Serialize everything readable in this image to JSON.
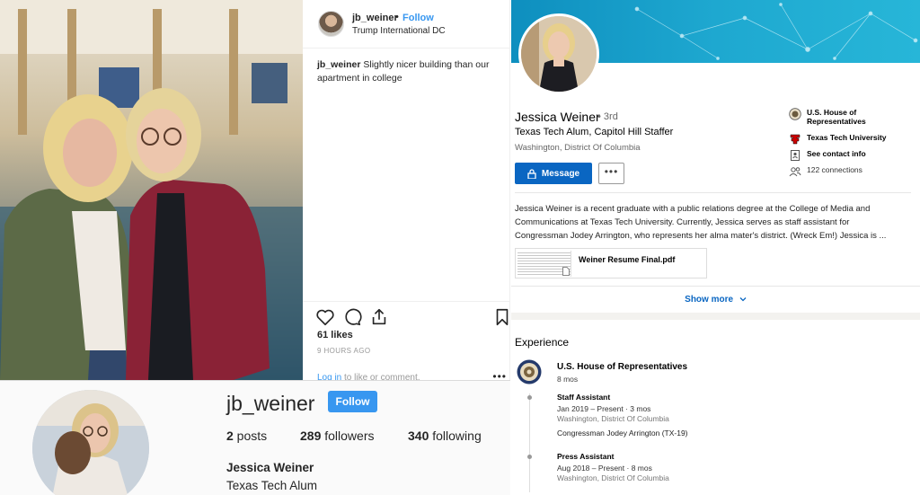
{
  "instagram_post": {
    "username": "jb_weiner",
    "separator": "•",
    "follow_label": "Follow",
    "location": "Trump International DC",
    "caption_user": "jb_weiner",
    "caption_text": "Slightly nicer building than our apartment in college",
    "likes": "61 likes",
    "time": "9 HOURS AGO",
    "login_link": "Log in",
    "login_rest": " to like or comment.",
    "more": "•••"
  },
  "instagram_profile": {
    "username": "jb_weiner",
    "follow_label": "Follow",
    "posts_count": "2",
    "posts_label": " posts",
    "followers_count": "289",
    "followers_label": " followers",
    "following_count": "340",
    "following_label": " following",
    "full_name": "Jessica Weiner",
    "bio": "Texas Tech Alum"
  },
  "linkedin": {
    "name": "Jessica Weiner",
    "degree": "• 3rd",
    "headline": "Texas Tech Alum, Capitol Hill Staffer",
    "location": "Washington, District Of Columbia",
    "message_label": "Message",
    "more_label": "•••",
    "side": {
      "org1_line1": "U.S. House of",
      "org1_line2": "Representatives",
      "school": "Texas Tech University",
      "contact": "See contact info",
      "connections": "122 connections"
    },
    "about_l1": "Jessica Weiner is a recent graduate with a public relations degree at the College of Media and",
    "about_l2": "Communications at Texas Tech University. Currently, Jessica serves as staff assistant for",
    "about_l3": "Congressman Jodey Arrington, who represents her alma mater's district. (Wreck Em!) Jessica is ...",
    "file_name": "Weiner Resume Final.pdf",
    "show_more": "Show more",
    "experience": {
      "title": "Experience",
      "org": "U.S. House of Representatives",
      "org_duration": "8 mos",
      "roles": [
        {
          "title": "Staff Assistant",
          "dates": "Jan 2019 – Present · 3 mos",
          "location": "Washington, District Of Columbia",
          "description": "Congressman Jodey Arrington (TX-19)"
        },
        {
          "title": "Press Assistant",
          "dates": "Aug 2018 – Present · 8 mos",
          "location": "Washington, District Of Columbia"
        }
      ]
    }
  },
  "colors": {
    "instagram_blue": "#3897f0",
    "linkedin_blue": "#0a66c2",
    "banner_teal": "#1ea8d0"
  }
}
